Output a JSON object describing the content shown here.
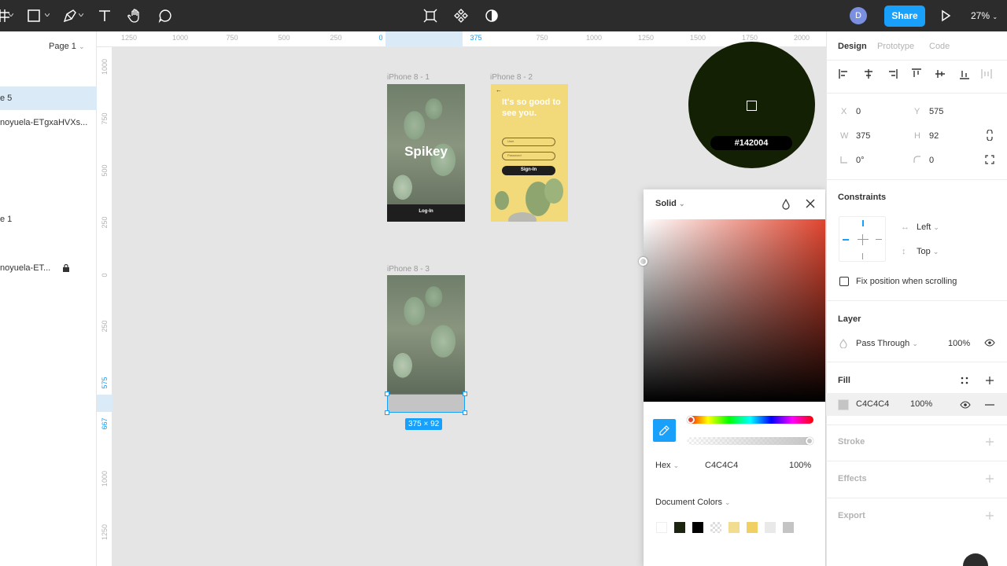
{
  "toolbar": {
    "avatar_initial": "D",
    "share_label": "Share",
    "zoom": "27%"
  },
  "left_panel": {
    "page_selector": "Page 1",
    "layers": [
      {
        "label": "e 5",
        "selected": true
      },
      {
        "label": "noyuela-ETgxaHVXs...",
        "selected": false
      },
      {
        "label": "e 1",
        "selected": false
      },
      {
        "label": "noyuela-ET...",
        "selected": false,
        "locked": true
      }
    ]
  },
  "rulers": {
    "top": [
      "1250",
      "1000",
      "750",
      "500",
      "250",
      "0",
      "375",
      "750",
      "1000",
      "1250",
      "1500",
      "1750",
      "2000"
    ],
    "left": [
      "1000",
      "750",
      "500",
      "250",
      "0",
      "250",
      "575",
      "667",
      "1000",
      "1250"
    ]
  },
  "canvas": {
    "frames": [
      {
        "label": "iPhone 8 - 1",
        "title": "Spikey",
        "button": "Log-In"
      },
      {
        "label": "iPhone 8 - 2",
        "heading": "It's so good to see you.",
        "field_user": "User",
        "field_password": "Password",
        "button": "Sign-In"
      },
      {
        "label": "iPhone 8 - 3"
      }
    ],
    "size_badge": "375 × 92",
    "loupe_hex": "#142004"
  },
  "color_picker": {
    "mode": "Solid",
    "format": "Hex",
    "hex": "C4C4C4",
    "opacity": "100%",
    "document_colors_label": "Document Colors",
    "swatches": [
      "#ffffff",
      "#1c2410",
      "#000000",
      "checker",
      "#f2dc8f",
      "#f0cf63",
      "#e9e9e9",
      "#c4c4c4"
    ]
  },
  "design_panel": {
    "tabs": [
      "Design",
      "Prototype",
      "Code"
    ],
    "x_label": "X",
    "x": "0",
    "y_label": "Y",
    "y": "575",
    "w_label": "W",
    "w": "375",
    "h_label": "H",
    "h": "92",
    "rotation": "0°",
    "radius": "0",
    "constraints_title": "Constraints",
    "constraint_h": "Left",
    "constraint_v": "Top",
    "fix_scroll": "Fix position when scrolling",
    "layer_title": "Layer",
    "blend": "Pass Through",
    "layer_opacity": "100%",
    "fill_title": "Fill",
    "fill_hex": "C4C4C4",
    "fill_opacity": "100%",
    "stroke_title": "Stroke",
    "effects_title": "Effects",
    "export_title": "Export"
  },
  "colors": {
    "accent": "#18a0fb",
    "selection": "#dbeaf7",
    "loupe": "#142004",
    "fill": "#c4c4c4"
  }
}
